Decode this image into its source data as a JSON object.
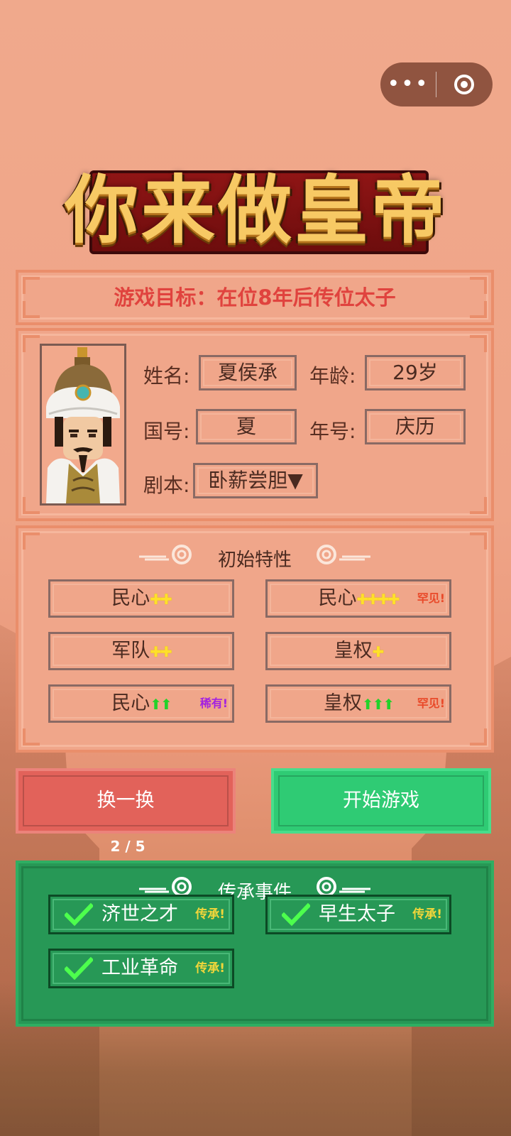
{
  "title": "你来做皇帝",
  "capsule": {
    "more_icon": "more-icon",
    "close_icon": "target-icon"
  },
  "goal": {
    "text": "游戏目标：在位8年后传位太子"
  },
  "profile": {
    "name_label": "姓名:",
    "name_value": "夏侯承",
    "age_label": "年龄:",
    "age_value": "29岁",
    "country_label": "国号:",
    "country_value": "夏",
    "era_label": "年号:",
    "era_value": "庆历",
    "script_label": "剧本:",
    "script_value": "卧薪尝胆▼"
  },
  "traits": {
    "title": "初始特性",
    "items": [
      {
        "name": "民心",
        "symbols": "✚✚",
        "symbol_color": "yellow",
        "tag": "",
        "tag_type": ""
      },
      {
        "name": "民心",
        "symbols": "✚✚✚✚",
        "symbol_color": "yellow",
        "tag": "罕见!",
        "tag_type": "scarce"
      },
      {
        "name": "军队",
        "symbols": "✚✚",
        "symbol_color": "yellow",
        "tag": "",
        "tag_type": ""
      },
      {
        "name": "皇权",
        "symbols": "✚",
        "symbol_color": "yellow",
        "tag": "",
        "tag_type": ""
      },
      {
        "name": "民心",
        "symbols": "⬆⬆",
        "symbol_color": "green",
        "tag": "稀有!",
        "tag_type": "rare"
      },
      {
        "name": "皇权",
        "symbols": "⬆⬆⬆",
        "symbol_color": "green",
        "tag": "罕见!",
        "tag_type": "scarce"
      }
    ]
  },
  "buttons": {
    "swap": "换一换",
    "start": "开始游戏",
    "counter": "2 / 5"
  },
  "legacy": {
    "title": "传承事件",
    "items": [
      {
        "name": "济世之才",
        "tag": "传承!"
      },
      {
        "name": "早生太子",
        "tag": "传承!"
      },
      {
        "name": "工业革命",
        "tag": "传承!"
      }
    ]
  }
}
